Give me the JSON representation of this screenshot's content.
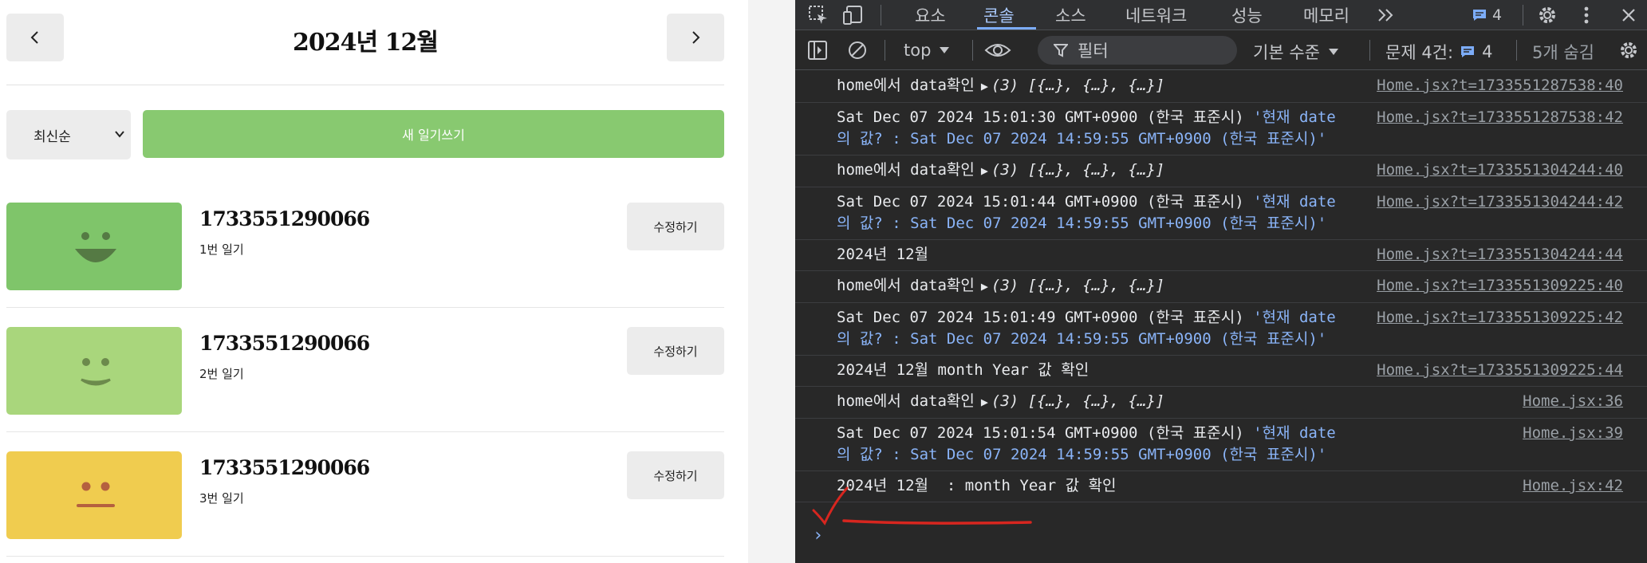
{
  "app": {
    "header": {
      "title": "2024년 12월",
      "prev_icon": "chevron-left-icon",
      "next_icon": "chevron-right-icon"
    },
    "sort": {
      "selected": "최신순",
      "icon": "chevron-down-icon"
    },
    "new_button_label": "새 일기쓰기",
    "diaries": [
      {
        "date": "1733551290066",
        "content": "1번 일기",
        "emotion_color": "#7fc56a",
        "face": "happy",
        "edit_label": "수정하기"
      },
      {
        "date": "1733551290066",
        "content": "2번 일기",
        "emotion_color": "#a9d67c",
        "face": "smile",
        "edit_label": "수정하기"
      },
      {
        "date": "1733551290066",
        "content": "3번 일기",
        "emotion_color": "#f0cc4f",
        "face": "neutral",
        "edit_label": "수정하기"
      }
    ]
  },
  "devtools": {
    "tabs": [
      "요소",
      "콘솔",
      "소스",
      "네트워크",
      "성능",
      "메모리"
    ],
    "active_tab": "콘솔",
    "issue_badge_count": "4",
    "toolbar": {
      "context": "top",
      "filter_placeholder": "필터",
      "level": "기본 수준",
      "issues_label": "문제 4건:",
      "issues_count": "4",
      "hidden_label": "5개 숨김"
    },
    "logs": [
      {
        "text": "home에서 data확인",
        "obj": "(3) [{…}, {…}, {…}]",
        "src": "Home.jsx?t=1733551287538:40"
      },
      {
        "text": "Sat Dec 07 2024 15:01:30 GMT+0900 (한국 표준시)",
        "str": "'현재 date의 값? : Sat Dec 07 2024 14:59:55 GMT+0900 (한국 표준시)'",
        "src": "Home.jsx?t=1733551287538:42"
      },
      {
        "text": "home에서 data확인",
        "obj": "(3) [{…}, {…}, {…}]",
        "src": "Home.jsx?t=1733551304244:40"
      },
      {
        "text": "Sat Dec 07 2024 15:01:44 GMT+0900 (한국 표준시)",
        "str": "'현재 date의 값? : Sat Dec 07 2024 14:59:55 GMT+0900 (한국 표준시)'",
        "src": "Home.jsx?t=1733551304244:42"
      },
      {
        "text": "2024년 12월",
        "src": "Home.jsx?t=1733551304244:44"
      },
      {
        "text": "home에서 data확인",
        "obj": "(3) [{…}, {…}, {…}]",
        "src": "Home.jsx?t=1733551309225:40"
      },
      {
        "text": "Sat Dec 07 2024 15:01:49 GMT+0900 (한국 표준시)",
        "str": "'현재 date의 값? : Sat Dec 07 2024 14:59:55 GMT+0900 (한국 표준시)'",
        "src": "Home.jsx?t=1733551309225:42"
      },
      {
        "text": "2024년 12월 month Year 값 확인",
        "src": "Home.jsx?t=1733551309225:44"
      },
      {
        "text": "home에서 data확인",
        "obj": "(3) [{…}, {…}, {…}]",
        "src": "Home.jsx:36"
      },
      {
        "text": "Sat Dec 07 2024 15:01:54 GMT+0900 (한국 표준시)",
        "str": "'현재 date의 값? : Sat Dec 07 2024 14:59:55 GMT+0900 (한국 표준시)'",
        "src": "Home.jsx:39"
      },
      {
        "text": "2024년 12월  : month Year 값 확인",
        "src": "Home.jsx:42"
      }
    ],
    "prompt": "›"
  }
}
